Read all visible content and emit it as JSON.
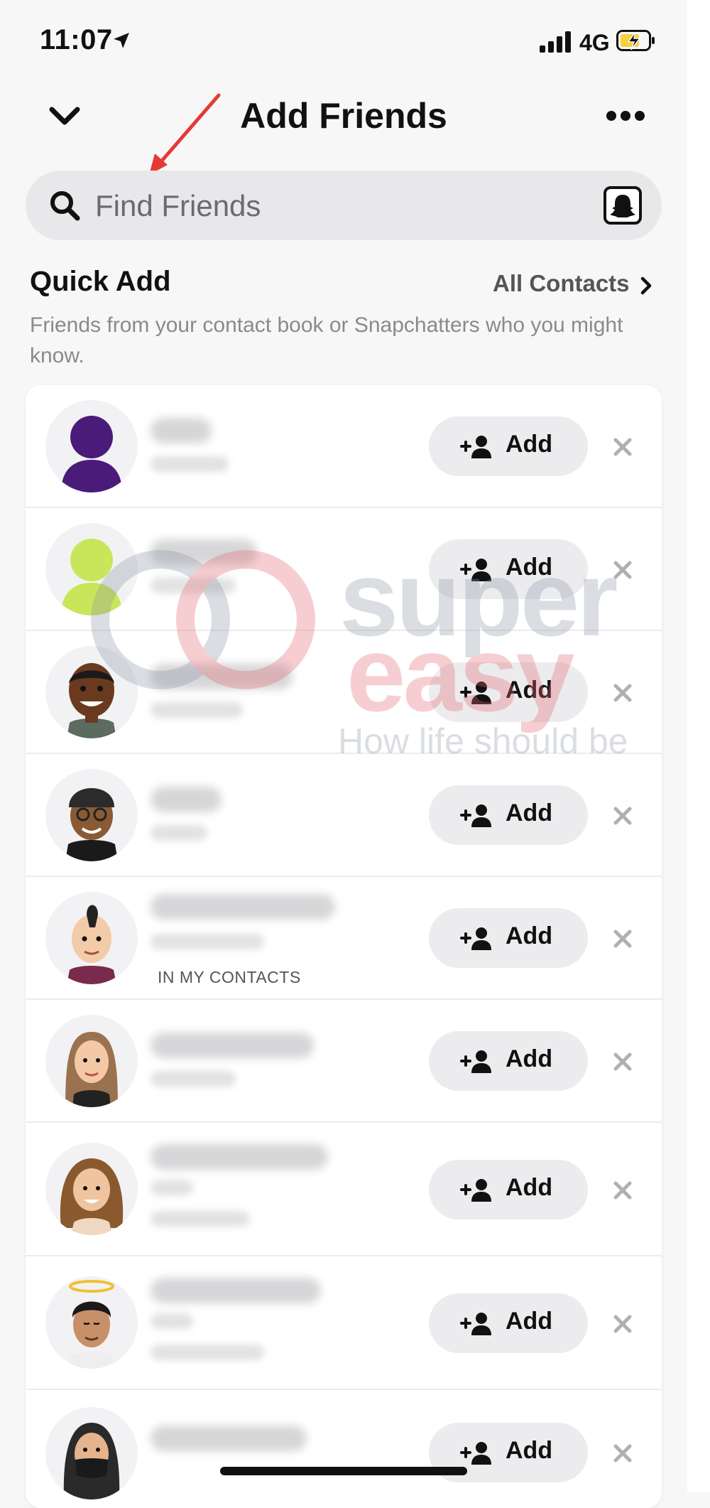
{
  "status_bar": {
    "time": "11:07",
    "network": "4G"
  },
  "header": {
    "title": "Add Friends"
  },
  "search": {
    "placeholder": "Find Friends"
  },
  "quick_add": {
    "title": "Quick Add",
    "all_contacts_label": "All Contacts",
    "description": "Friends from your contact book or Snapchatters who you might know."
  },
  "rows": [
    {
      "avatar": "purple-silhouette-avatar",
      "tag": "",
      "add_label": "Add"
    },
    {
      "avatar": "green-silhouette-avatar",
      "tag": "",
      "add_label": "Add"
    },
    {
      "avatar": "bitmoji-smiling-man-avatar",
      "tag": "",
      "add_label": "Add"
    },
    {
      "avatar": "bitmoji-beanie-glasses-avatar",
      "tag": "",
      "add_label": "Add"
    },
    {
      "avatar": "bitmoji-mohawk-avatar",
      "tag": "IN MY CONTACTS",
      "add_label": "Add"
    },
    {
      "avatar": "bitmoji-long-hair-woman-avatar",
      "tag": "",
      "add_label": "Add"
    },
    {
      "avatar": "bitmoji-wavy-hair-woman-avatar",
      "tag": "",
      "add_label": "Add"
    },
    {
      "avatar": "bitmoji-halo-avatar",
      "tag": "",
      "add_label": "Add"
    },
    {
      "avatar": "bitmoji-masked-avatar",
      "tag": "",
      "add_label": "Add"
    }
  ],
  "watermark": {
    "brand_top": "super",
    "brand_bottom": "easy",
    "tagline": "How life should be"
  },
  "colors": {
    "background": "#f7f7f8",
    "card": "#ffffff",
    "button": "#ececee",
    "annotation_arrow": "#e53935",
    "battery": "#f5d13c"
  }
}
